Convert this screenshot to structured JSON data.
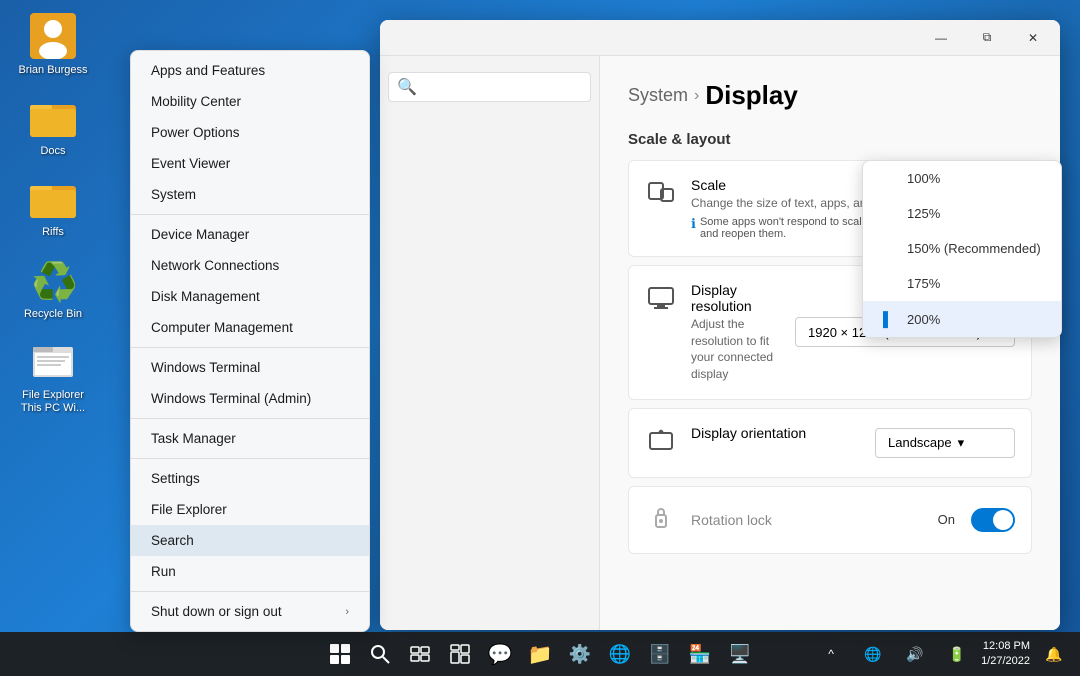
{
  "desktop": {
    "background": "blue gradient",
    "icons": [
      {
        "id": "brian",
        "emoji": "👤",
        "label": "Brian Burgess"
      },
      {
        "id": "docs",
        "emoji": "📁",
        "label": "Docs"
      },
      {
        "id": "riffs",
        "emoji": "📁",
        "label": "Riffs"
      },
      {
        "id": "recycle",
        "emoji": "♻️",
        "label": "Recycle Bin"
      },
      {
        "id": "fileexplorer",
        "emoji": "📄",
        "label": "File Explorer This PC Wi..."
      }
    ]
  },
  "taskbar": {
    "start_icon": "⊞",
    "search_icon": "🔍",
    "taskview_icon": "⬜",
    "widgets_icon": "▦",
    "chat_icon": "💬",
    "explorer_icon": "📁",
    "settings_icon": "⚙️",
    "edge_icon": "🌐",
    "app1_icon": "🗄️",
    "store_icon": "🏪",
    "dell_icon": "🖥️",
    "time": "12:08 PM",
    "date": "1/27/2022",
    "sys_tray_icons": [
      "^",
      "🌐",
      "💬",
      "🔊",
      "🔋",
      "🔔"
    ]
  },
  "settings_window": {
    "title": "Display",
    "breadcrumb_parent": "System",
    "breadcrumb_separator": "›",
    "breadcrumb_current": "Display",
    "minimize_label": "—",
    "restore_label": "⧉",
    "close_label": "✕",
    "sections": {
      "scale_layout": {
        "title": "Scale & layout",
        "scale": {
          "name": "Scale",
          "description": "Change the size of text, apps, and other items",
          "note": "Some apps won't respond to scaling changes until you close and reopen them.",
          "icon": "⊡"
        },
        "resolution": {
          "name": "Display resolution",
          "description": "Adjust the resolution to fit your connected display",
          "value": "1920 × 1200 (Recommended)",
          "icon": "⊡"
        },
        "orientation": {
          "name": "Display orientation",
          "value": "Landscape",
          "icon": "⊡"
        },
        "rotation_lock": {
          "name": "Rotation lock",
          "state": "On",
          "icon": "🔒"
        }
      }
    }
  },
  "context_menu": {
    "items": [
      {
        "label": "Apps and Features",
        "id": "apps-features"
      },
      {
        "label": "Mobility Center",
        "id": "mobility-center"
      },
      {
        "label": "Power Options",
        "id": "power-options"
      },
      {
        "label": "Event Viewer",
        "id": "event-viewer"
      },
      {
        "label": "System",
        "id": "system"
      },
      {
        "label": "Device Manager",
        "id": "device-manager"
      },
      {
        "label": "Network Connections",
        "id": "network-connections"
      },
      {
        "label": "Disk Management",
        "id": "disk-management"
      },
      {
        "label": "Computer Management",
        "id": "computer-management"
      },
      {
        "label": "Windows Terminal",
        "id": "windows-terminal"
      },
      {
        "label": "Windows Terminal (Admin)",
        "id": "windows-terminal-admin"
      },
      {
        "label": "Task Manager",
        "id": "task-manager"
      },
      {
        "label": "Settings",
        "id": "settings"
      },
      {
        "label": "File Explorer",
        "id": "file-explorer"
      },
      {
        "label": "Search",
        "id": "search"
      },
      {
        "label": "Run",
        "id": "run"
      },
      {
        "label": "Shut down or sign out",
        "id": "shutdown",
        "has_arrow": true
      }
    ],
    "highlighted_item": "search"
  },
  "scale_popup": {
    "options": [
      {
        "label": "100%",
        "selected": false
      },
      {
        "label": "125%",
        "selected": false
      },
      {
        "label": "150% (Recommended)",
        "selected": false
      },
      {
        "label": "175%",
        "selected": false
      },
      {
        "label": "200%",
        "selected": true
      }
    ]
  }
}
